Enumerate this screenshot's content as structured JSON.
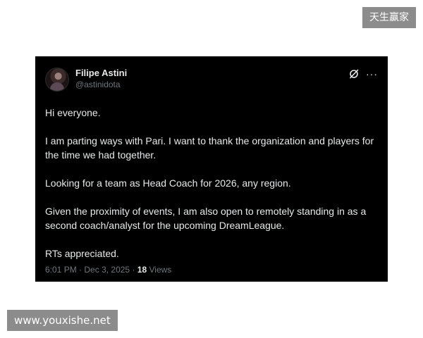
{
  "watermarks": {
    "top_right": "天生赢家",
    "bottom_left": "www.youxishe.net"
  },
  "tweet": {
    "author": {
      "display_name": "Filipe Astini",
      "handle": "@astinidota"
    },
    "icons": {
      "grok": "grok-icon",
      "more": "more-options-icon"
    },
    "paragraphs": [
      "Hi everyone.",
      "I am parting ways with Pari. I want to thank the organization and players for the time we had together.",
      "Looking for a team as Head Coach for 2026, any region.",
      "Given the proximity of events, I am also open to remotely standing in as a second coach/analyst for the upcoming DreamLeague.",
      "RTs appreciated."
    ],
    "meta": {
      "time": "6:01 PM",
      "separator": "·",
      "date": "Dec 3, 2025",
      "views_count": "18",
      "views_label": "Views"
    }
  },
  "colors": {
    "card_background": "#000000",
    "primary_text": "#e7e9ea",
    "secondary_text": "#71767b",
    "watermark_background": "#8c8c8c"
  }
}
